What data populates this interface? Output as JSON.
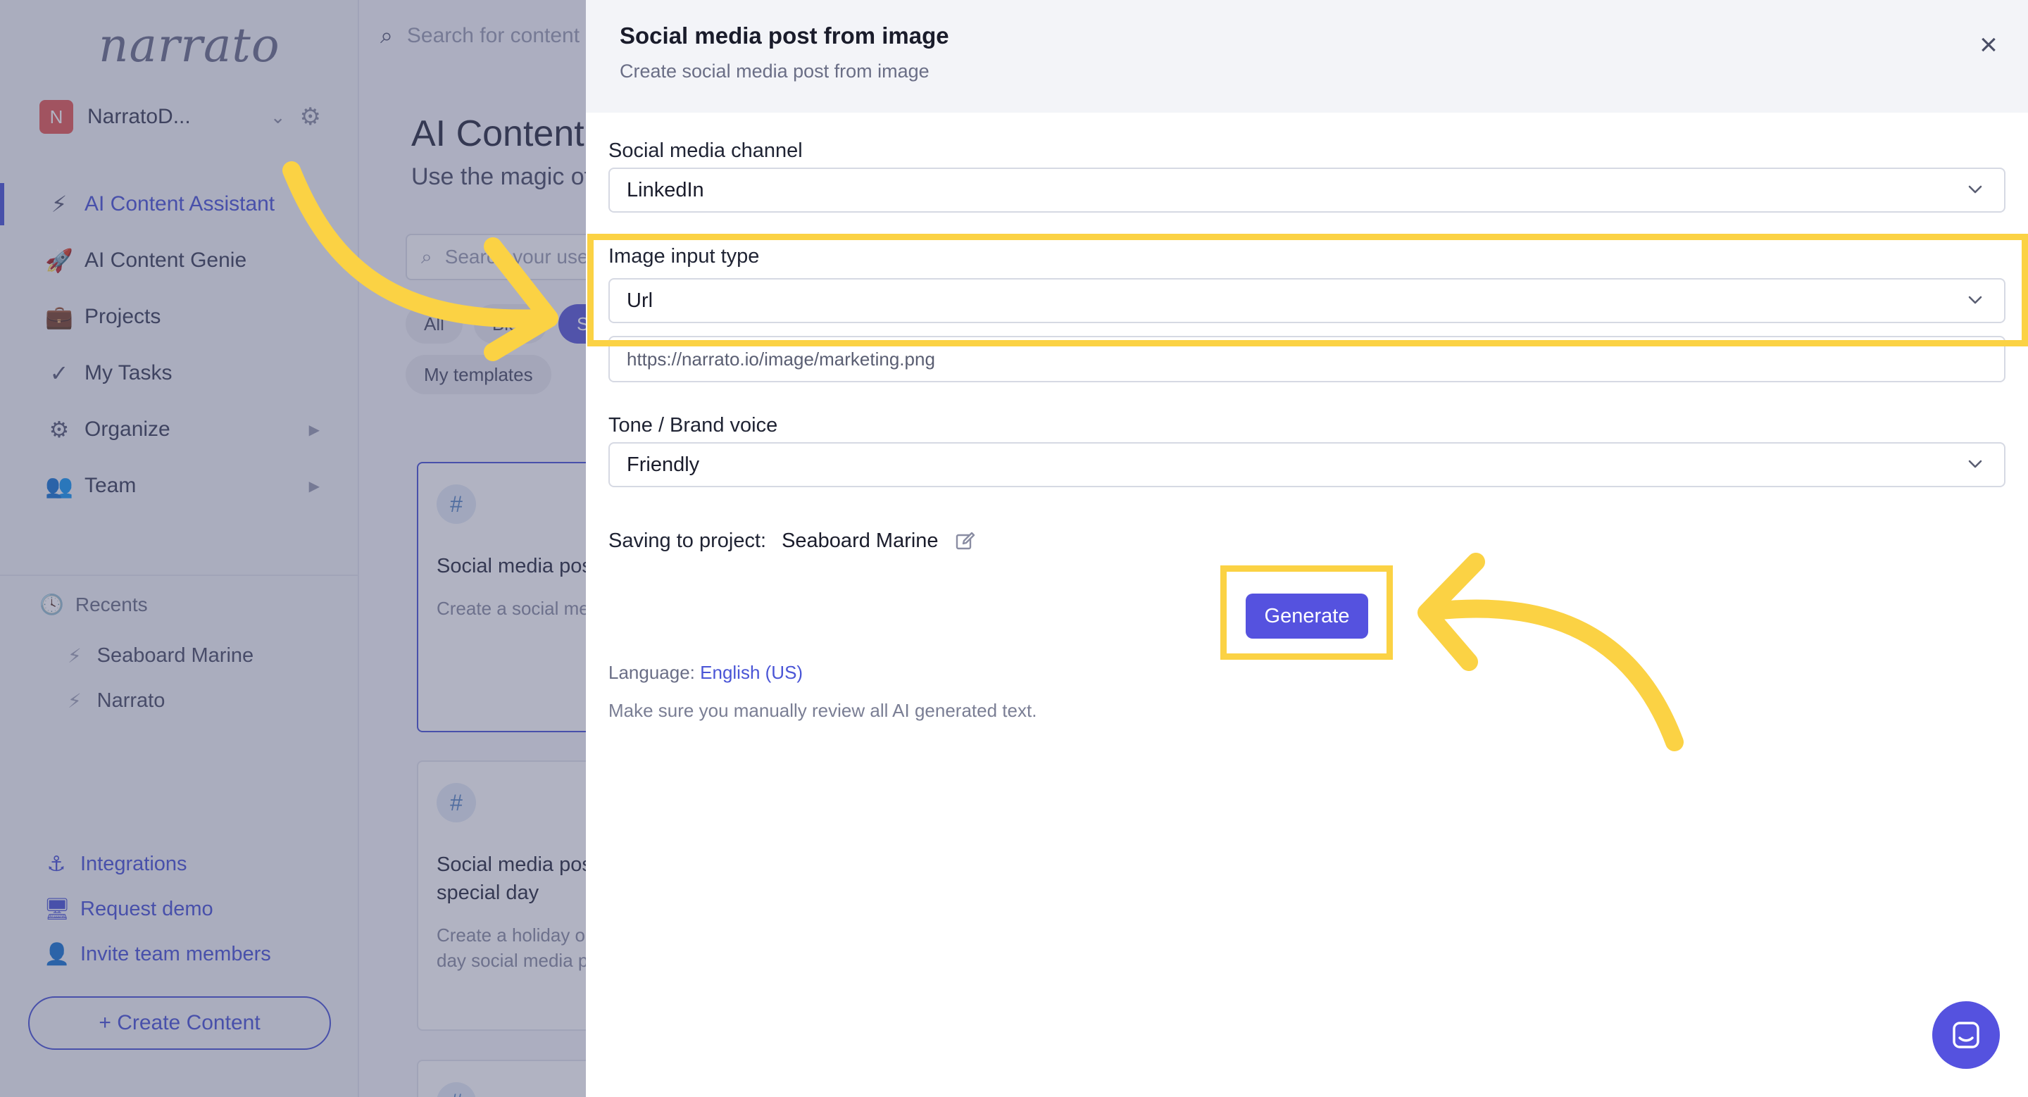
{
  "app": {
    "logo": "narrato",
    "workspace": {
      "badge": "N",
      "name": "NarratoD..."
    },
    "nav": [
      {
        "label": "AI Content Assistant",
        "icon": "bolt-icon",
        "glyph": "⚡"
      },
      {
        "label": "AI Content Genie",
        "icon": "rocket-icon",
        "glyph": "🚀"
      },
      {
        "label": "Projects",
        "icon": "briefcase-icon",
        "glyph": "💼"
      },
      {
        "label": "My Tasks",
        "icon": "check-icon",
        "glyph": "✓"
      },
      {
        "label": "Organize",
        "icon": "gears-icon",
        "glyph": "⚙"
      },
      {
        "label": "Team",
        "icon": "team-icon",
        "glyph": "👥"
      }
    ],
    "recents": {
      "title": "Recents",
      "items": [
        "Seaboard Marine",
        "Narrato"
      ]
    },
    "bottom_links": [
      {
        "label": "Integrations",
        "icon": "anchor-icon",
        "glyph": "⚓"
      },
      {
        "label": "Request demo",
        "icon": "monitor-icon",
        "glyph": "🖥"
      },
      {
        "label": "Invite team members",
        "icon": "add-user-icon",
        "glyph": "👤"
      }
    ],
    "create_button": "+ Create Content"
  },
  "main": {
    "search_placeholder": "Search for content",
    "title": "AI Content Assistant",
    "subtitle": "Use the magic of AI",
    "template_search_placeholder": "Search your use case",
    "chips": [
      "All",
      "Blog",
      "Social"
    ],
    "my_templates": "My templates",
    "cards": [
      {
        "title": "Social media post",
        "desc": "Create a social media post"
      },
      {
        "title": "Social media post for special day",
        "desc": "Create a holiday or special day social media post"
      }
    ]
  },
  "drawer": {
    "title": "Social media post from image",
    "subtitle": "Create social media post from image",
    "fields": {
      "channel": {
        "label": "Social media channel",
        "value": "LinkedIn"
      },
      "input_type": {
        "label": "Image input type",
        "value": "Url"
      },
      "url": {
        "value": "https://narrato.io/image/marketing.png"
      },
      "tone": {
        "label": "Tone / Brand voice",
        "value": "Friendly"
      }
    },
    "saving": {
      "label": "Saving to project:",
      "project": "Seaboard Marine"
    },
    "generate_label": "Generate",
    "language": {
      "label": "Language:",
      "value": "English (US)"
    },
    "disclaimer": "Make sure you manually review all AI generated text."
  },
  "colors": {
    "accent": "#5552df",
    "highlight": "#fbd244",
    "overlay": "#464a6e"
  }
}
